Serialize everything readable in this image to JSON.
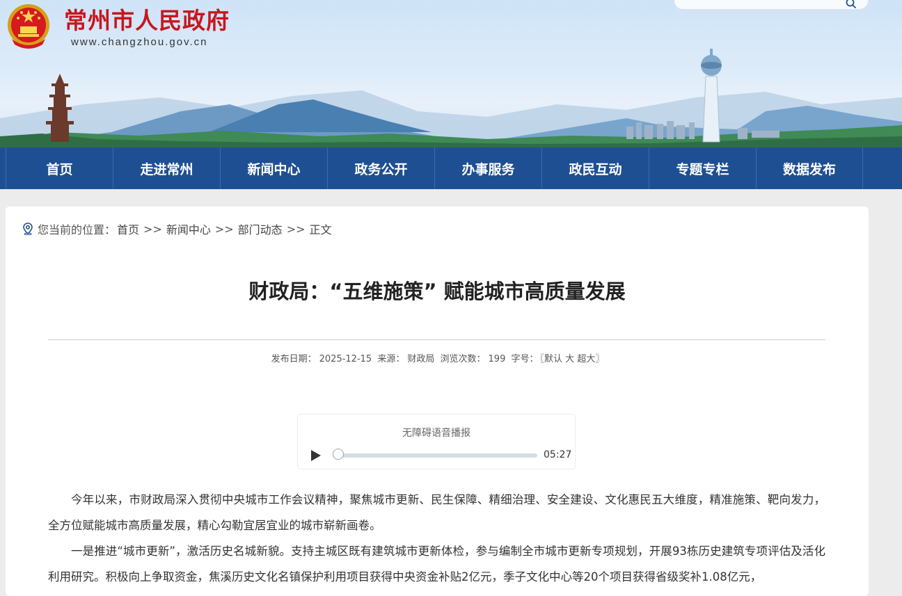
{
  "header": {
    "site_title": "常州市人民政府",
    "site_url": "www.changzhou.gov.cn",
    "search_placeholder": ""
  },
  "nav": {
    "items": [
      "首页",
      "走进常州",
      "新闻中心",
      "政务公开",
      "办事服务",
      "政民互动",
      "专题专栏",
      "数据发布"
    ]
  },
  "breadcrumb": {
    "label": "您当前的位置：",
    "items": [
      "首页",
      "新闻中心",
      "部门动态",
      "正文"
    ],
    "separator": ">>"
  },
  "article": {
    "title": "财政局：“五维施策” 赋能城市高质量发展",
    "meta": {
      "date_label": "发布日期：",
      "date": "2025-12-15",
      "source_label": "来源：",
      "source": "财政局",
      "views_label": "浏览次数：",
      "views": "199",
      "fontsize_label": "字号：",
      "fontsize_open": "〖",
      "fontsize_options": [
        "默认",
        "大",
        "超大"
      ],
      "fontsize_close": "〗"
    },
    "paragraphs": [
      "今年以来，市财政局深入贯彻中央城市工作会议精神，聚焦城市更新、民生保障、精细治理、安全建设、文化惠民五大维度，精准施策、靶向发力，全方位赋能城市高质量发展，精心勾勒宜居宜业的城市崭新画卷。",
      "一是推进“城市更新”，激活历史名城新貌。支持主城区既有建筑城市更新体检，参与编制全市城市更新专项规划，开展93栋历史建筑专项评估及活化利用研究。积极向上争取资金，焦溪历史文化名镇保护利用项目获得中央资金补贴2亿元，季子文化中心等20个项目获得省级奖补1.08亿元，"
    ]
  },
  "player": {
    "title": "无障碍语音播报",
    "duration": "05:27",
    "progress": 0
  },
  "colors": {
    "brand_red": "#c8161d",
    "nav_blue": "#1f4f93",
    "page_bg": "#ececec"
  }
}
